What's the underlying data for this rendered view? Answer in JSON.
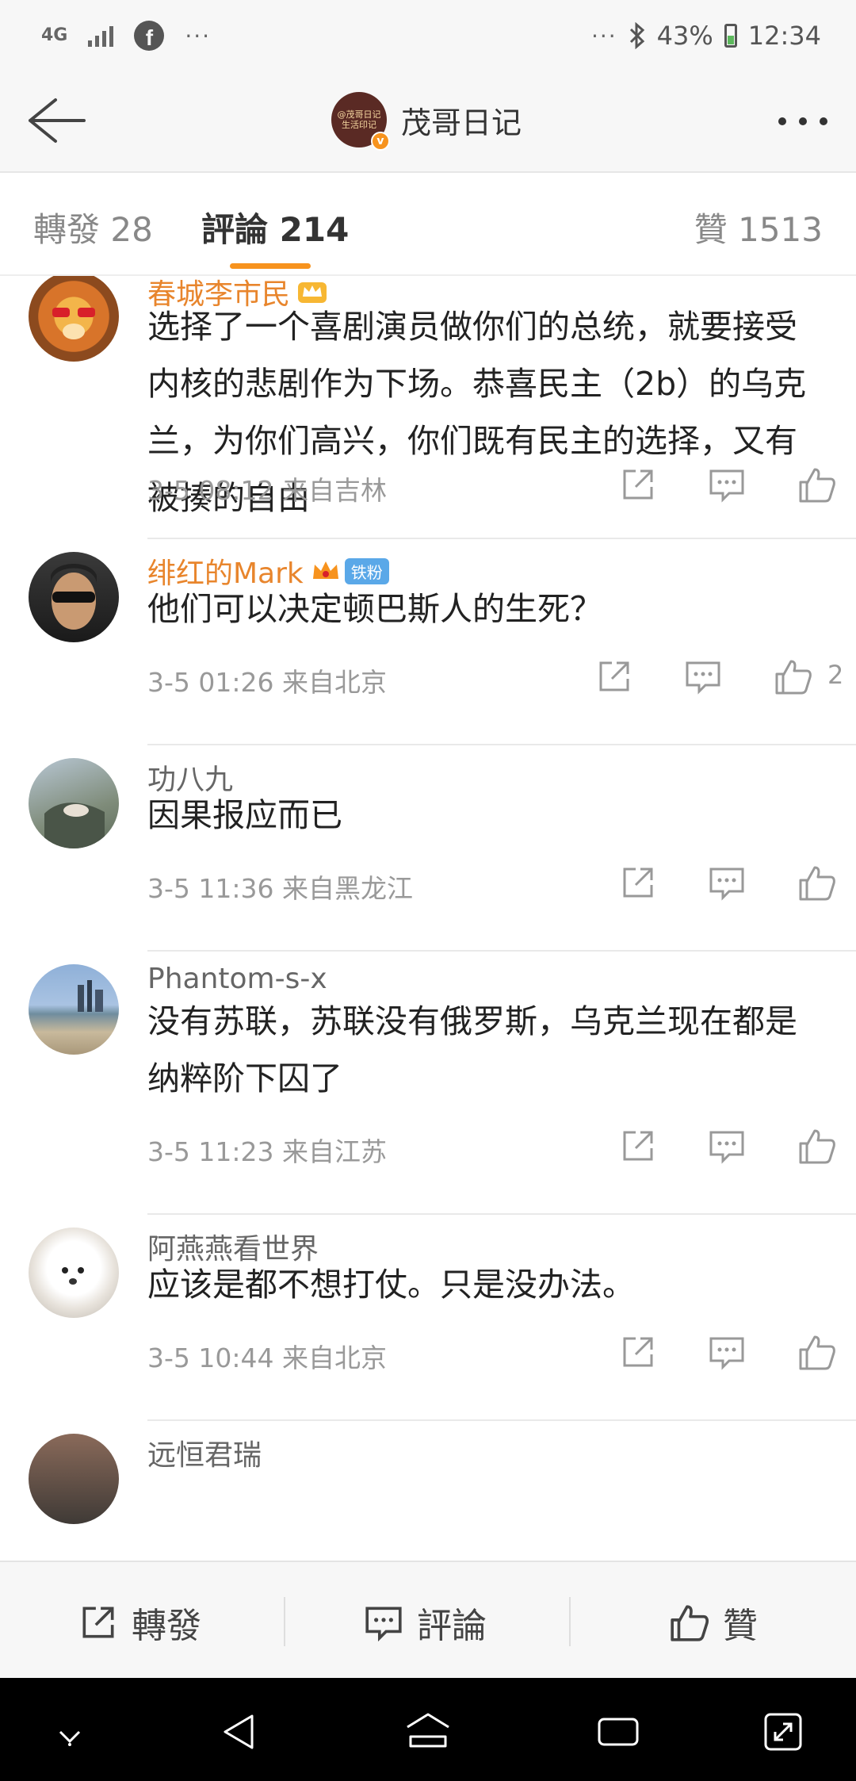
{
  "status_bar": {
    "network": "4G",
    "more": "···",
    "battery": "43%",
    "time": "12:34"
  },
  "header": {
    "title": "茂哥日记",
    "avatar_text_1": "@茂哥日记",
    "avatar_text_2": "生活印记"
  },
  "tabs": [
    {
      "label": "轉發 28"
    },
    {
      "label": "評論 214"
    },
    {
      "label": "贊 1513"
    }
  ],
  "comments": [
    {
      "name": "春城李市民",
      "text": "选择了一个喜剧演员做你们的总统，就要接受内核的悲剧作为下场。恭喜民主（2b）的乌克兰，为你们高兴，你们既有民主的选择，又有被揍的自由",
      "time": "3-5 08:12",
      "source": "来自吉林",
      "likes": ""
    },
    {
      "name": "绯红的Mark",
      "badge": "铁粉",
      "text": "他们可以决定顿巴斯人的生死？",
      "time": "3-5 01:26",
      "source": "来自北京",
      "likes": "2"
    },
    {
      "name": "功八九",
      "text": "因果报应而已",
      "time": "3-5 11:36",
      "source": "来自黑龙江",
      "likes": ""
    },
    {
      "name": "Phantom-s-x",
      "text": "没有苏联，苏联没有俄罗斯，乌克兰现在都是纳粹阶下囚了",
      "time": "3-5 11:23",
      "source": "来自江苏",
      "likes": ""
    },
    {
      "name": "阿燕燕看世界",
      "text": "应该是都不想打仗。只是没办法。",
      "time": "3-5 10:44",
      "source": "来自北京",
      "likes": ""
    },
    {
      "name": "远恒君瑞",
      "text": "",
      "time": "",
      "source": "",
      "likes": ""
    }
  ],
  "toolbar": {
    "repost": "轉發",
    "comment": "評論",
    "like": "贊"
  },
  "colors": {
    "accent": "#f7931e",
    "vip_name": "#e8852c",
    "meta": "#999999"
  }
}
